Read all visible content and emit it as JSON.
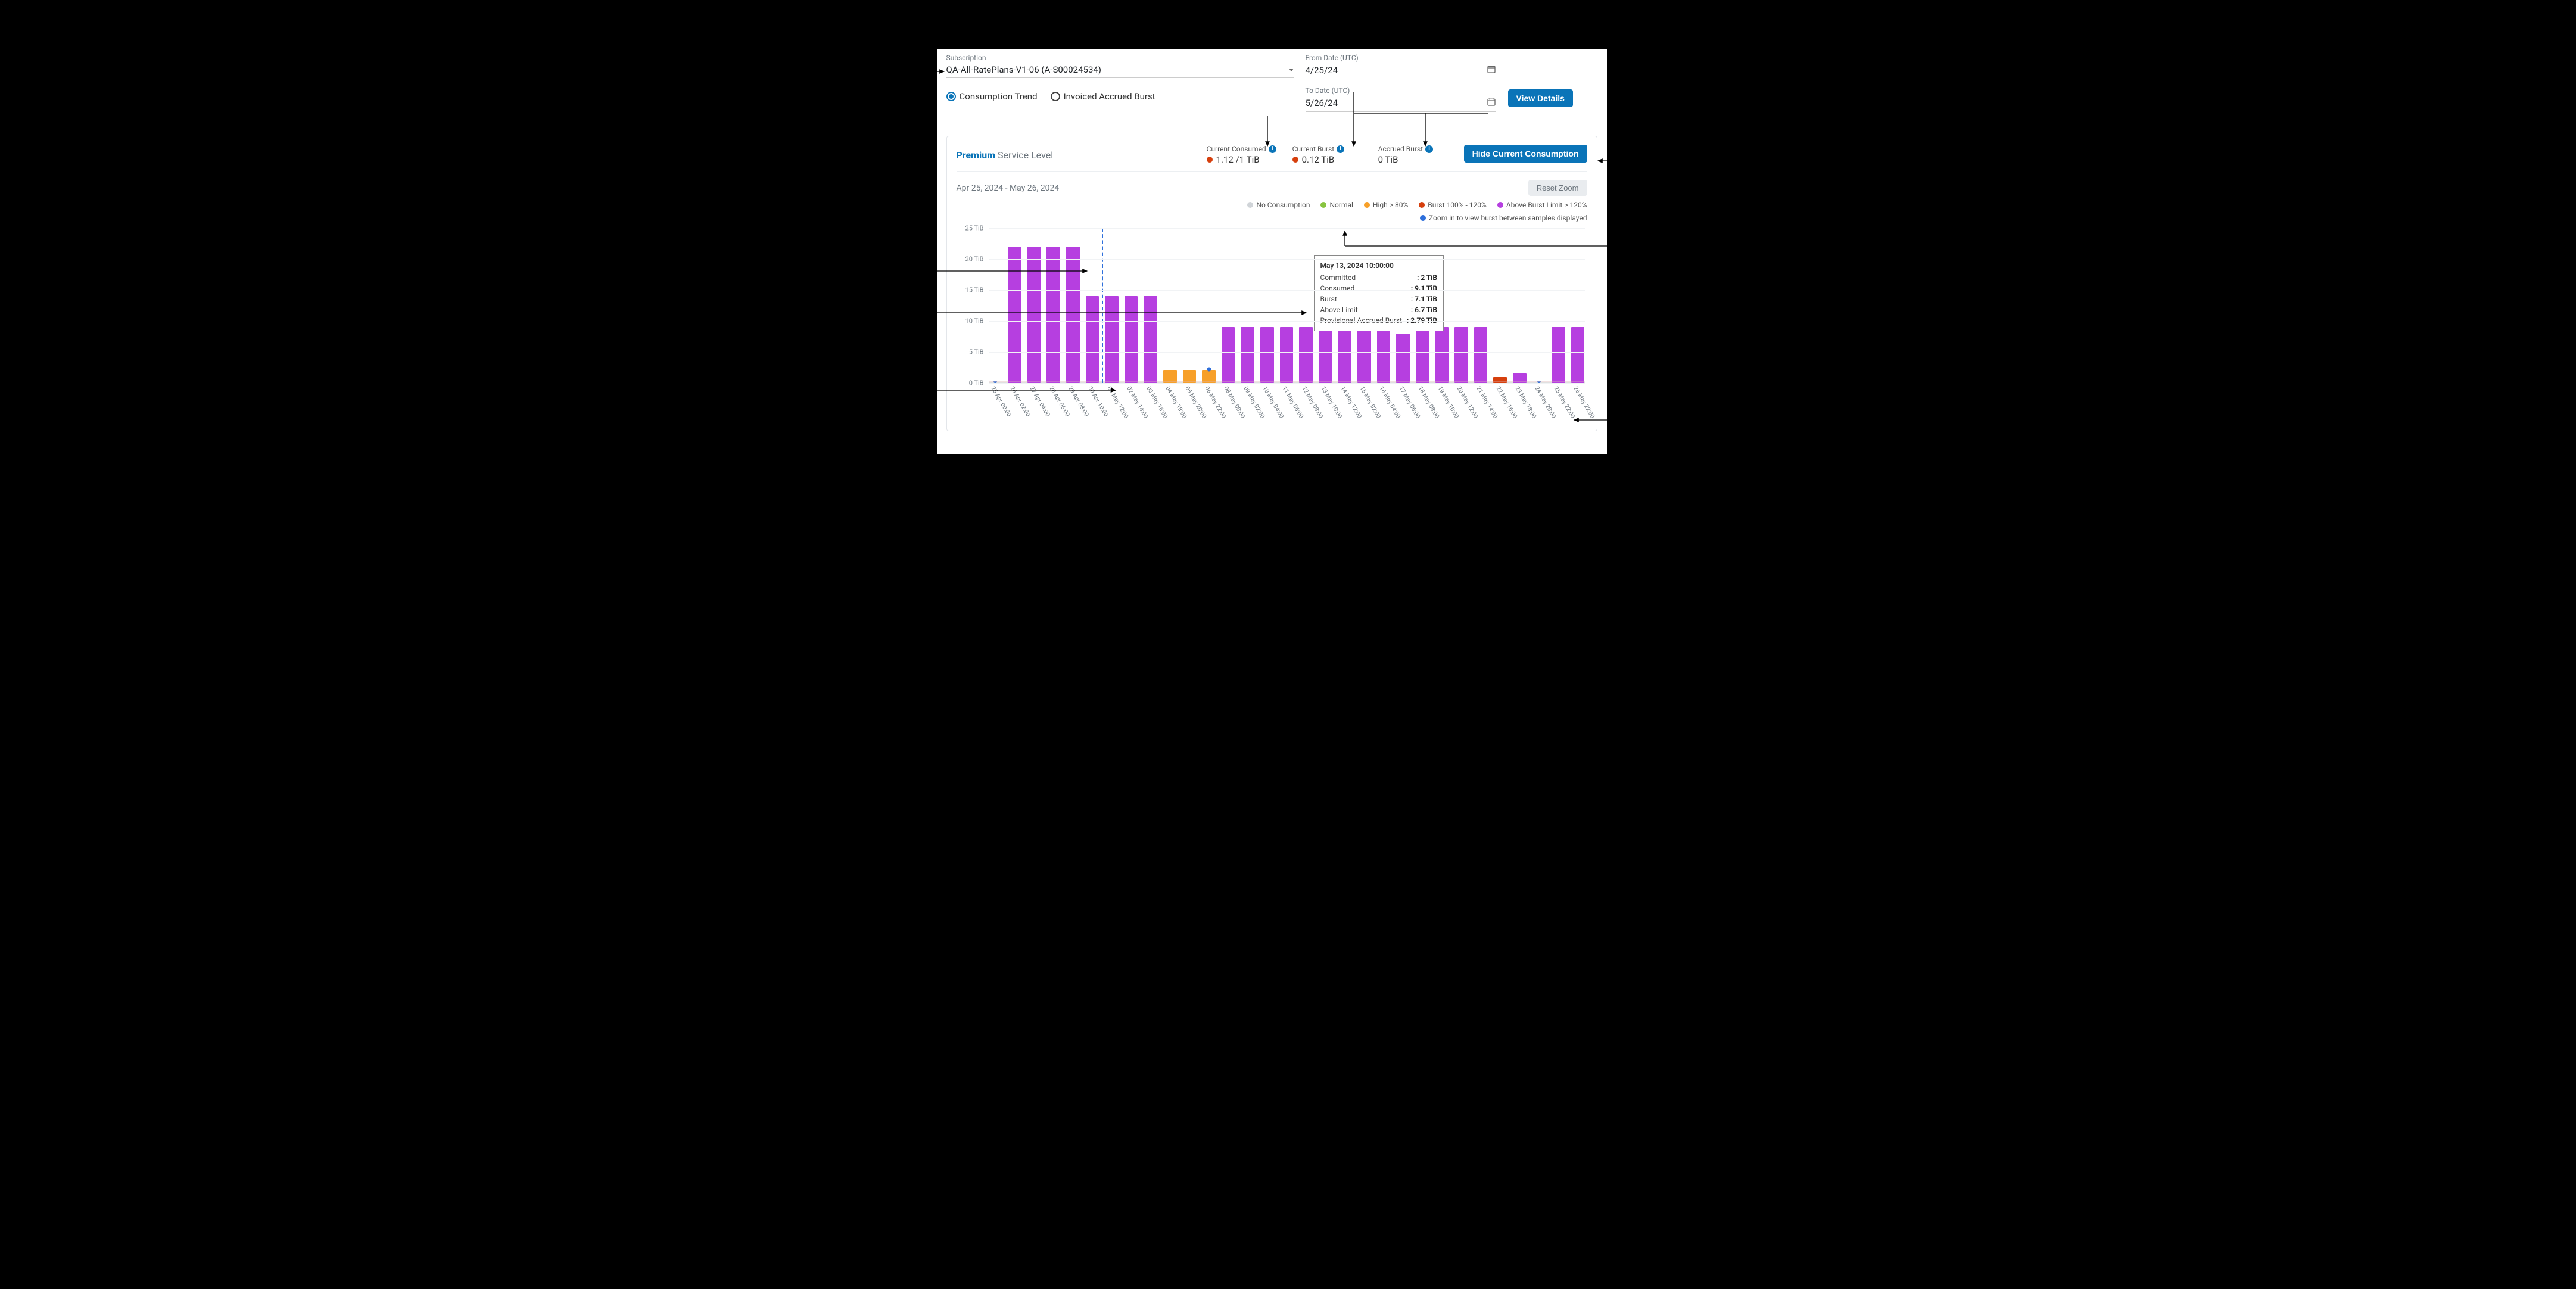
{
  "colors": {
    "primary": "#0a74b8",
    "no_consumption": "#d0d4d8",
    "normal": "#88c440",
    "high": "#f7a029",
    "burst": "#d63f0d",
    "above_burst": "#b63fe0",
    "zoom_dot": "#2e6fdb",
    "reset_bg": "#e9ecef"
  },
  "filters": {
    "subscription_label": "Subscription",
    "subscription_value": "QA-All-RatePlans-V1-06 (A-S00024534)",
    "from_label": "From Date (UTC)",
    "from_value": "4/25/24",
    "to_label": "To Date (UTC)",
    "to_value": "5/26/24",
    "view_details_label": "View Details"
  },
  "radios": {
    "consumption_trend": "Consumption Trend",
    "invoiced_burst": "Invoiced Accrued Burst"
  },
  "card": {
    "service_level_premium": "Premium",
    "service_level_text": "Service Level",
    "metrics": {
      "current_consumed_label": "Current Consumed",
      "current_consumed_value": "1.12 /1 TiB",
      "current_burst_label": "Current Burst",
      "current_burst_value": "0.12 TiB",
      "accrued_burst_label": "Accrued Burst",
      "accrued_burst_value": "0 TiB"
    },
    "hide_current_label": "Hide Current Consumption",
    "date_range": "Apr 25, 2024 - May 26, 2024",
    "reset_zoom_label": "Reset Zoom"
  },
  "legend": {
    "no_consumption": "No Consumption",
    "normal": "Normal",
    "high": "High > 80%",
    "burst": "Burst 100% - 120%",
    "above_burst": "Above Burst Limit > 120%",
    "zoom_hint": "Zoom in to view burst between samples displayed"
  },
  "tooltip": {
    "title": "May 13, 2024 10:00:00",
    "committed_label": "Committed",
    "committed_value": ": 2 TiB",
    "consumed_label": "Consumed",
    "consumed_value": ": 9.1 TiB",
    "burst_label": "Burst",
    "burst_value": ": 7.1 TiB",
    "above_limit_label": "Above Limit",
    "above_limit_value": ": 6.7 TiB",
    "prov_label": "Provisional Accrued Burst",
    "prov_value": ": 2.79 TiB"
  },
  "chart_data": {
    "type": "bar",
    "ylabel": "",
    "ylim": [
      0,
      25
    ],
    "yticks": [
      "0 TiB",
      "5 TiB",
      "10 TiB",
      "15 TiB",
      "20 TiB",
      "25 TiB"
    ],
    "categories": [
      "25 Apr 00:00",
      "26 Apr 02:00",
      "27 Apr 04:00",
      "28 Apr 06:00",
      "29 Apr 08:00",
      "30 Apr 10:00",
      "01 May 12:00",
      "02 May 14:00",
      "03 May 16:00",
      "04 May 18:00",
      "05 May 20:00",
      "06 May 22:00",
      "08 May 00:00",
      "09 May 02:00",
      "10 May 04:00",
      "11 May 06:00",
      "12 May 08:00",
      "13 May 10:00",
      "14 May 12:00",
      "15 May 02:00",
      "16 May 04:00",
      "17 May 06:00",
      "18 May 08:00",
      "19 May 10:00",
      "20 May 12:00",
      "21 May 14:00",
      "22 May 16:00",
      "23 May 18:00",
      "24 May 20:00",
      "25 May 22:00",
      "26 May 22:00"
    ],
    "values": [
      0,
      22,
      22,
      22,
      22,
      14,
      14,
      14,
      14,
      2,
      2,
      2,
      9,
      9,
      9,
      9,
      9,
      9,
      9,
      9,
      9,
      8,
      9,
      9,
      9,
      9,
      1,
      1.5,
      0,
      9,
      9
    ],
    "bar_status": [
      "no_consumption",
      "above_burst",
      "above_burst",
      "above_burst",
      "above_burst",
      "above_burst",
      "above_burst",
      "above_burst",
      "above_burst",
      "high",
      "high",
      "high",
      "above_burst",
      "above_burst",
      "above_burst",
      "above_burst",
      "above_burst",
      "above_burst",
      "above_burst",
      "above_burst",
      "above_burst",
      "above_burst",
      "above_burst",
      "above_burst",
      "above_burst",
      "above_burst",
      "burst",
      "above_burst",
      "no_consumption",
      "above_burst",
      "above_burst"
    ],
    "cursor_index": 5
  }
}
